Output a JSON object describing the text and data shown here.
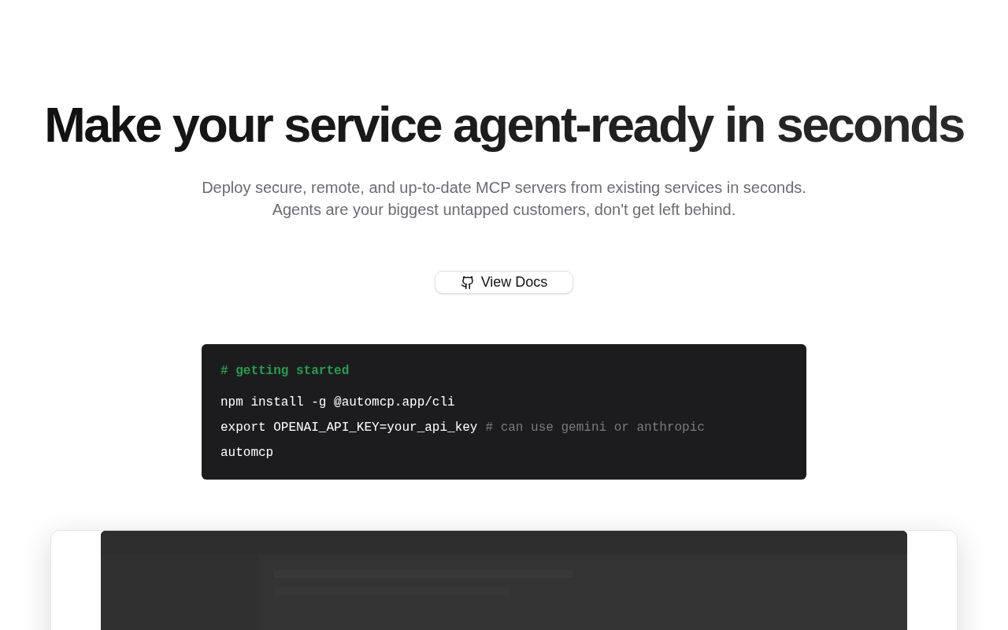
{
  "hero": {
    "title": "Make your service agent-ready in seconds",
    "subtitle_lines": [
      "Deploy secure, remote, and up-to-date MCP servers from existing services in seconds.",
      "Agents are your biggest untapped customers, don't get left behind."
    ]
  },
  "docs_button": {
    "label": "View Docs"
  },
  "code_block": {
    "lines": [
      {
        "kind": "comment-heading",
        "text": "# getting started"
      },
      {
        "kind": "command",
        "text": "npm install -g @automcp.app/cli"
      },
      {
        "kind": "command",
        "text": "export OPENAI_API_KEY=your_api_key",
        "comment": "# can use gemini or anthropic"
      },
      {
        "kind": "command",
        "text": "automcp"
      }
    ]
  }
}
